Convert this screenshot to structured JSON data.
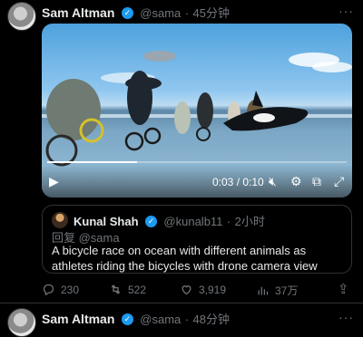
{
  "tweet": {
    "author_name": "Sam Altman",
    "handle": "@sama",
    "time": "45分钟",
    "separator": "·"
  },
  "video": {
    "current_time": "0:03",
    "duration": "0:10",
    "time_separator": " / ",
    "progress": 0.3
  },
  "quote": {
    "author_name": "Kunal Shah",
    "handle": "@kunalb11",
    "time": "2小时",
    "reply_to": "回复 @sama",
    "text": "A bicycle race on ocean with different animals as athletes riding the bicycles with drone camera view"
  },
  "actions": {
    "replies": "230",
    "retweets": "522",
    "likes": "3,919",
    "views": "37万"
  },
  "next_tweet": {
    "author_name": "Sam Altman",
    "handle": "@sama",
    "time": "48分钟"
  }
}
